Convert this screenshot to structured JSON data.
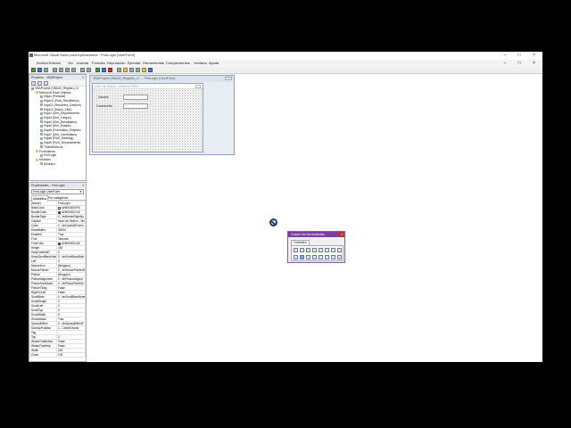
{
  "window": {
    "title": "Microsoft Visual Basic para Aplicaciones - FrmLogin [UserForm]",
    "controls": "–  □  ×"
  },
  "menu": {
    "items": [
      "Archivo",
      "Edición",
      "Ver",
      "Insertar",
      "Formato",
      "Depuración",
      "Ejecutar",
      "Herramientas",
      "Complementos",
      "Ventana",
      "Ayuda"
    ],
    "doc_controls": "–  □  ×"
  },
  "toolbar": {
    "position": ""
  },
  "project": {
    "title": "Proyecto - VBAProject",
    "close": "×",
    "tree": [
      {
        "indent": 0,
        "icon": "m",
        "text": "VBAProject (VBA00_Registro_U"
      },
      {
        "indent": 1,
        "icon": "f",
        "text": "Microsoft Excel Objetos"
      },
      {
        "indent": 2,
        "icon": "s",
        "text": "Hoja1 (Portada)"
      },
      {
        "indent": 2,
        "icon": "s",
        "text": "Hoja10 (Punt_Resultados)"
      },
      {
        "indent": 2,
        "icon": "s",
        "text": "Hoja11 (Resumen_Gestión)"
      },
      {
        "indent": 2,
        "icon": "s",
        "text": "Hoja12 (Datos_VBA)"
      },
      {
        "indent": 2,
        "icon": "s",
        "text": "Hoja2 (Dim_Departamento"
      },
      {
        "indent": 2,
        "icon": "s",
        "text": "Hoja3 (Dim_Cargos)"
      },
      {
        "indent": 2,
        "icon": "s",
        "text": "Hoja4 (Dim_Resultados)"
      },
      {
        "indent": 2,
        "icon": "s",
        "text": "Hoja5 (Dim_Estado)"
      },
      {
        "indent": 2,
        "icon": "s",
        "text": "Hoja6 (Formulario_Registro"
      },
      {
        "indent": 2,
        "icon": "s",
        "text": "Hoja7 (Dim_Candidatos)"
      },
      {
        "indent": 2,
        "icon": "s",
        "text": "Hoja8 (Punt_Ranking)"
      },
      {
        "indent": 2,
        "icon": "s",
        "text": "Hoja9 (Punt_Departamento"
      },
      {
        "indent": 2,
        "icon": "s",
        "text": "ThisWorkbook"
      },
      {
        "indent": 1,
        "icon": "f",
        "text": "Formularios"
      },
      {
        "indent": 2,
        "icon": "s",
        "text": "FrmLogin"
      },
      {
        "indent": 1,
        "icon": "f",
        "text": "Módulos"
      },
      {
        "indent": 2,
        "icon": "s",
        "text": "Módulo1"
      }
    ]
  },
  "properties": {
    "title": "Propiedades - FrmLogin",
    "close": "×",
    "object": "FrmLogin UserForm",
    "tabs": [
      "Alfabética",
      "Por categorías"
    ],
    "rows": [
      {
        "k": "(Name)",
        "v": "FrmLogin"
      },
      {
        "k": "BackColor",
        "v": "&H8000000F&",
        "sw": "#f0f0f0"
      },
      {
        "k": "BorderColor",
        "v": "&H80000012&",
        "sw": "#000000"
      },
      {
        "k": "BorderStyle",
        "v": "0 - fmBorderStyleNo"
      },
      {
        "k": "Caption",
        "v": "Inicio de Sesión - Sis"
      },
      {
        "k": "Cycle",
        "v": "0 - fmCycleAllForms"
      },
      {
        "k": "DrawBuffer",
        "v": "32000"
      },
      {
        "k": "Enabled",
        "v": "True"
      },
      {
        "k": "Font",
        "v": "Tahoma"
      },
      {
        "k": "ForeColor",
        "v": "&H80000012&",
        "sw": "#000000"
      },
      {
        "k": "Height",
        "v": "150"
      },
      {
        "k": "HelpContextID",
        "v": "0"
      },
      {
        "k": "KeepScrollBarsVisible",
        "v": "3 - fmScrollBarsBoth"
      },
      {
        "k": "Left",
        "v": "0"
      },
      {
        "k": "MouseIcon",
        "v": "(Ninguno)"
      },
      {
        "k": "MousePointer",
        "v": "0 - fmMousePointerD"
      },
      {
        "k": "Picture",
        "v": "(Ninguno)"
      },
      {
        "k": "PictureAlignment",
        "v": "2 - fmPictureAlignm"
      },
      {
        "k": "PictureSizeMode",
        "v": "0 - fmPictureSizeMo"
      },
      {
        "k": "PictureTiling",
        "v": "False"
      },
      {
        "k": "RightToLeft",
        "v": "False"
      },
      {
        "k": "ScrollBars",
        "v": "0 - fmScrollBarsNone"
      },
      {
        "k": "ScrollHeight",
        "v": "0"
      },
      {
        "k": "ScrollLeft",
        "v": "0"
      },
      {
        "k": "ScrollTop",
        "v": "0"
      },
      {
        "k": "ScrollWidth",
        "v": "0"
      },
      {
        "k": "ShowModal",
        "v": "True"
      },
      {
        "k": "SpecialEffect",
        "v": "0 - fmSpecialEffectF"
      },
      {
        "k": "StartUpPosition",
        "v": "1 - CenterOwner"
      },
      {
        "k": "Tag",
        "v": ""
      },
      {
        "k": "Top",
        "v": "0"
      },
      {
        "k": "WhatsThisButton",
        "v": "False"
      },
      {
        "k": "WhatsThisHelp",
        "v": "False"
      },
      {
        "k": "Width",
        "v": "240"
      },
      {
        "k": "Zoom",
        "v": "100"
      }
    ]
  },
  "designer": {
    "title": "VBAProject (VBA00_Registro_U... - FrmLogin (UserForm)",
    "form_caption": "Inicio de Sesión - Sistema RRHH",
    "usuario_label": "Usuario",
    "contrasena_label": "Contraseña"
  },
  "toolbox": {
    "title": "Cuadro de herramientas",
    "close": "×",
    "tab": "Controles"
  }
}
